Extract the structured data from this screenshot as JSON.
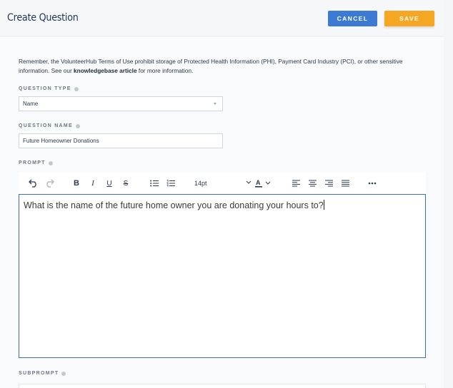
{
  "header": {
    "title": "Create Question",
    "cancel_label": "CANCEL",
    "save_label": "SAVE"
  },
  "notice": {
    "text_before": "Remember, the VolunteerHub Terms of Use prohibit storage of Protected Health Information (PHI), Payment Card Industry (PCI), or other sensitive information. See our ",
    "link_text": "knowledgebase article",
    "text_after": " for more information."
  },
  "question_type": {
    "label": "QUESTION TYPE",
    "value": "Name"
  },
  "question_name": {
    "label": "QUESTION NAME",
    "value": "Future Homeowner Donations"
  },
  "prompt": {
    "label": "PROMPT",
    "font_size": "14pt",
    "text": "What is the name of the future home owner you are donating your hours to?"
  },
  "subprompt": {
    "label": "SUBPROMPT"
  },
  "toolbar_icons": [
    "undo-icon",
    "redo-icon",
    "bold-icon",
    "italic-icon",
    "underline-icon",
    "strikethrough-icon",
    "bullet-list-icon",
    "numbered-list-icon",
    "font-color-icon",
    "align-left-icon",
    "align-center-icon",
    "align-right-icon",
    "align-justify-icon",
    "more-icon"
  ],
  "colors": {
    "cancel": "#3d7ad4",
    "save": "#f5a623",
    "editor_border": "#3d6fb0",
    "title": "#1f3554"
  }
}
